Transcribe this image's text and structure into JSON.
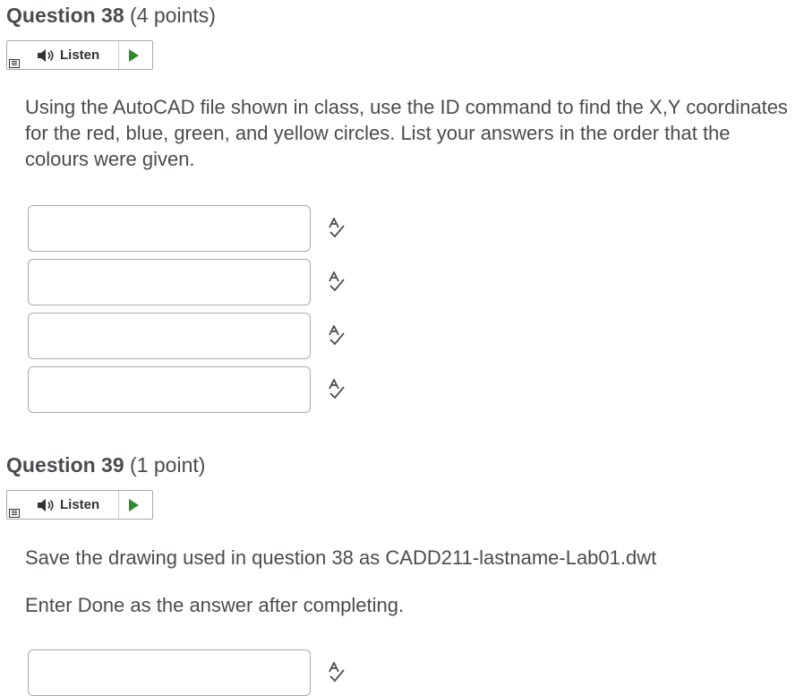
{
  "q38": {
    "title_num": "Question 38",
    "title_pts": "(4 points)",
    "listen_label": "Listen",
    "prompt": "Using the AutoCAD file shown in class, use the ID command to find the X,Y coordinates for the red, blue, green, and yellow circles.  List your answers in the order that the colours were given.",
    "answers": [
      "",
      "",
      "",
      ""
    ]
  },
  "q39": {
    "title_num": "Question 39",
    "title_pts": "(1 point)",
    "listen_label": "Listen",
    "prompt": "Save the drawing used in question 38 as CADD211-lastname-Lab01.dwt",
    "prompt2": "Enter Done as the answer after completing.",
    "answer": ""
  },
  "icons": {
    "menu": "menu-icon",
    "speaker": "speaker-icon",
    "play": "play-icon",
    "spellcheck": "spellcheck-icon"
  },
  "colors": {
    "text": "#494c4e",
    "border": "#a7abae",
    "play": "#2f8a2f"
  }
}
